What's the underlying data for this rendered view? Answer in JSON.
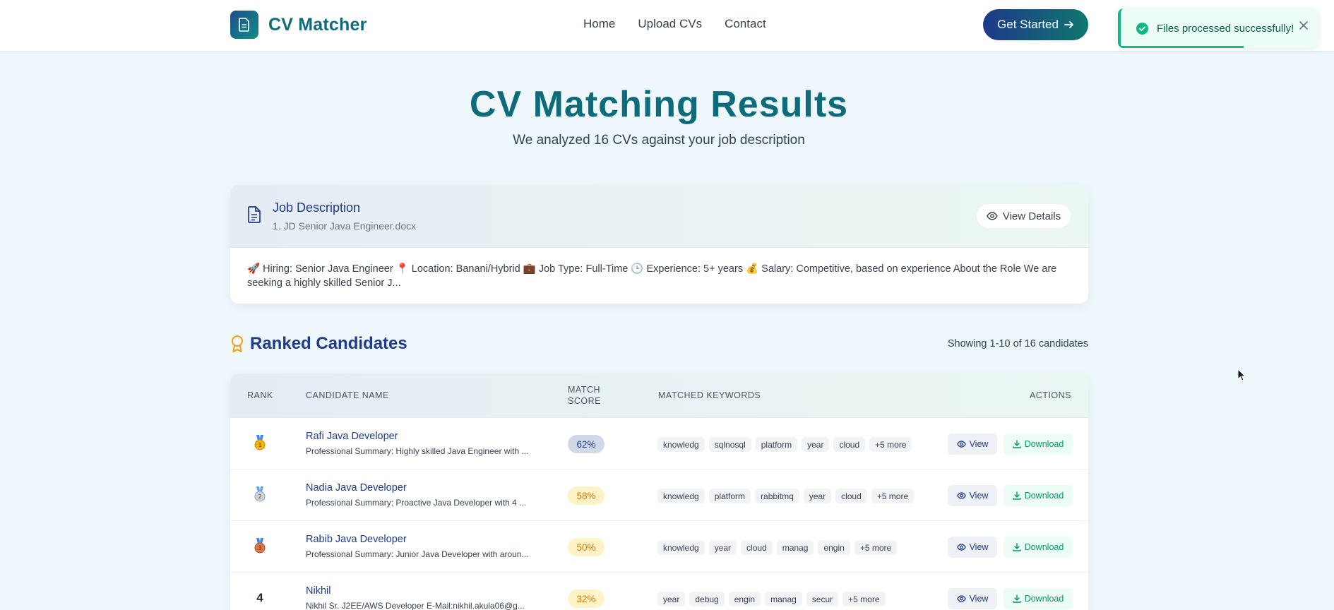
{
  "navbar": {
    "brand": "CV Matcher",
    "links": [
      "Home",
      "Upload CVs",
      "Contact"
    ],
    "cta": "Get Started"
  },
  "toast": {
    "message": "Files processed successfully!",
    "progress": 0.62
  },
  "page": {
    "title": "CV Matching Results",
    "subtitle": "We analyzed 16 CVs against your job description"
  },
  "job_description": {
    "title": "Job Description",
    "file": "1. JD Senior Java Engineer.docx",
    "view_label": "View Details",
    "summary": "🚀 Hiring: Senior Java Engineer 📍 Location: Banani/Hybrid 💼 Job Type: Full-Time 🕒 Experience: 5+ years 💰 Salary: Competitive, based on experience About the Role We are seeking a highly skilled Senior J..."
  },
  "ranked": {
    "title": "Ranked Candidates",
    "showing": "Showing 1-10 of 16 candidates"
  },
  "table": {
    "headers": {
      "rank": "RANK",
      "name": "CANDIDATE NAME",
      "score_line1": "MATCH",
      "score_line2": "SCORE",
      "keywords": "MATCHED KEYWORDS",
      "actions": "ACTIONS"
    },
    "view_label": "View",
    "download_label": "Download",
    "rows": [
      {
        "rank": "1",
        "medal": "gold",
        "name": "Rafi Java Developer",
        "summary": "Professional Summary: Highly skilled Java Engineer with ...",
        "score": "62%",
        "keywords": [
          "knowledg",
          "sqlnosql",
          "platform",
          "year",
          "cloud",
          "+5 more"
        ]
      },
      {
        "rank": "2",
        "medal": "silver",
        "name": "Nadia Java Developer",
        "summary": "Professional Summary: Proactive Java Developer with 4 ...",
        "score": "58%",
        "keywords": [
          "knowledg",
          "platform",
          "rabbitmq",
          "year",
          "cloud",
          "+5 more"
        ]
      },
      {
        "rank": "3",
        "medal": "bronze",
        "name": "Rabib Java Developer",
        "summary": "Professional Summary: Junior Java Developer with aroun...",
        "score": "50%",
        "keywords": [
          "knowledg",
          "year",
          "cloud",
          "manag",
          "engin",
          "+5 more"
        ]
      },
      {
        "rank": "4",
        "medal": "",
        "name": "Nikhil",
        "summary": "Nikhil Sr. J2EE/AWS Developer E-Mail:nikhil.akula06@g...",
        "score": "32%",
        "keywords": [
          "year",
          "debug",
          "engin",
          "manag",
          "secur",
          "+5 more"
        ]
      }
    ]
  },
  "colors": {
    "brand": "#0e6b7a",
    "navy": "#1e3a8a",
    "success": "#10b981",
    "background": "#eef7fb"
  }
}
